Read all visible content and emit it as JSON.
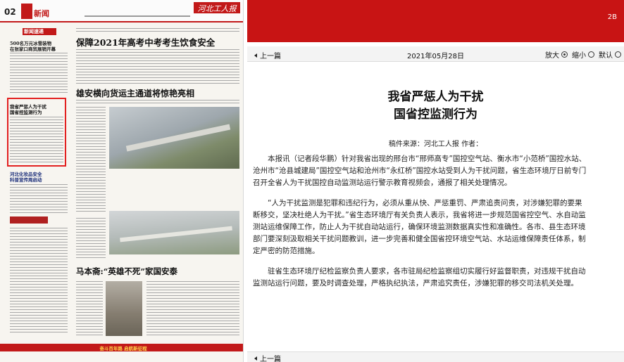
{
  "newspaper": {
    "page_number": "02",
    "section": "新闻",
    "logo": "河北工人报",
    "headlines": {
      "rail_label": "新闻速递",
      "brief_1": "500名万元冰雪装物",
      "brief_2": "在张家口商贸展销开幕",
      "main": "保障2021年高考中考考生饮食安全",
      "xiongan": "雄安横向货运主通道将惊艳亮相",
      "highlighted_1": "我省严惩人为干扰",
      "highlighted_2": "国省控监测行为",
      "food_1": "河北化妆品安全",
      "food_2": "科普宣传周启动",
      "ma": "马本斋:“英雄不死”家国安泰",
      "footer_banner": "奋斗百年路 启航新征程"
    }
  },
  "reader": {
    "edition": "2B",
    "nav": {
      "prev_label": "上一篇",
      "date": "2021年05月28日",
      "zoom_in_label": "放大",
      "zoom_out_label": "缩小",
      "default_label": "默认"
    },
    "article": {
      "title_line1": "我省严惩人为干扰",
      "title_line2": "国省控监测行为",
      "source": "稿件来源：河北工人报  作者：",
      "paragraphs": [
        "本报讯（记者段华鹏）针对我省出现的邢台市“邢师高专”国控空气站、衡水市“小范桥”国控水站、沧州市“沧县城建局”国控空气站和沧州市“永红桥”国控水站受到人为干扰问题，省生态环境厅日前专门召开全省人为干扰国控自动监测站运行警示教育视频会，通报了相关处理情况。",
        "“人为干扰监测是犯罪和违纪行为，必须从重从快、严惩重罚、严肃追责问责，对涉嫌犯罪的要果断移交，坚决杜绝人为干扰。”省生态环境厅有关负责人表示，我省将进一步规范国省控空气、水自动监测站运维保障工作，防止人为干扰自动站运行，确保环境监测数据真实性和准确性。各市、县生态环境部门要深刻汲取相关干扰问题教训，进一步完善和健全国省控环境空气站、水站运维保障责任体系，制定严密的防范措施。",
        "驻省生态环境厅纪检监察负责人要求，各市驻局纪检监察组切实履行好监督职责，对违规干扰自动监测站运行问题，要及时调查处理，严格执纪执法，严肃追究责任，涉嫌犯罪的移交司法机关处理。"
      ]
    },
    "bottom_prev_label": "上一篇"
  }
}
